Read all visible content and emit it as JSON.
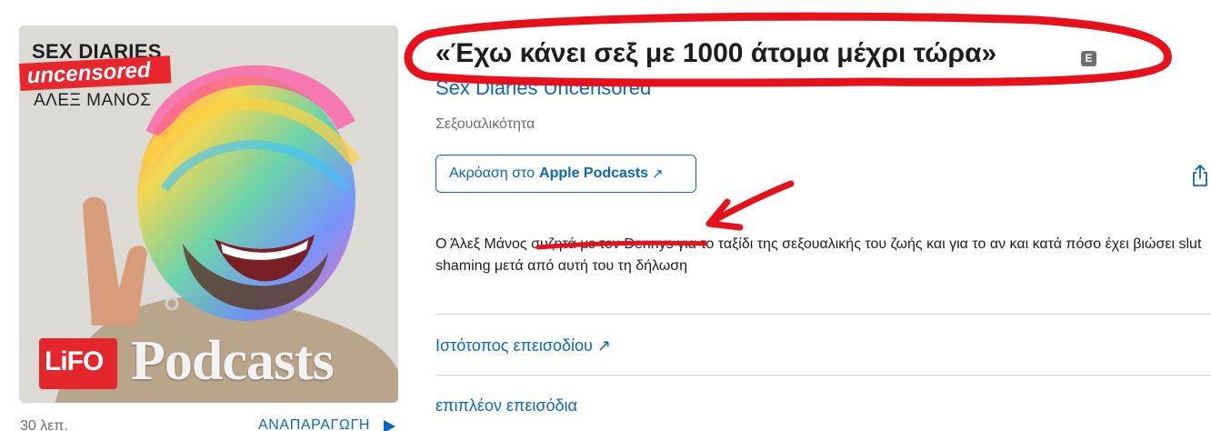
{
  "artwork": {
    "series_title": "SEX DIARIES",
    "series_tag": "uncensored",
    "author": "ΑΛΕΞ ΜΑΝΟΣ",
    "publisher_logo": "LiFO",
    "podcasts_word": "Podcasts"
  },
  "player": {
    "duration": "30 λεπ.",
    "play_label": "ΑΝΑΠΑΡΑΓΩΓΗ",
    "play_icon": "play-triangle-icon"
  },
  "episode": {
    "title": "«Έχω κάνει σεξ με 1000 άτομα μέχρι τώρα»",
    "explicit_badge": "E",
    "show_name": "Sex Diaries Uncensored",
    "category": "Σεξουαλικότητα",
    "listen_prefix": "Ακρόαση στο",
    "listen_brand": "Apple Podcasts",
    "listen_arrow": "↗",
    "description": "Ο Άλεξ Μάνος συζητά με τον Dennys για το ταξίδι της σεξουαλικής του ζωής και για το αν και κατά πόσο έχει βιώσει slut shaming μετά από αυτή του τη δήλωση",
    "links": {
      "episode_site": "Ιστότοπος επεισοδίου ↗",
      "more_episodes": "επιπλέον επεισόδια"
    }
  },
  "colors": {
    "link": "#0a66c2",
    "text": "#1d1d1f",
    "secondary": "#6e6e73",
    "annotation": "#e8101a",
    "divider": "#d2d2d7"
  }
}
